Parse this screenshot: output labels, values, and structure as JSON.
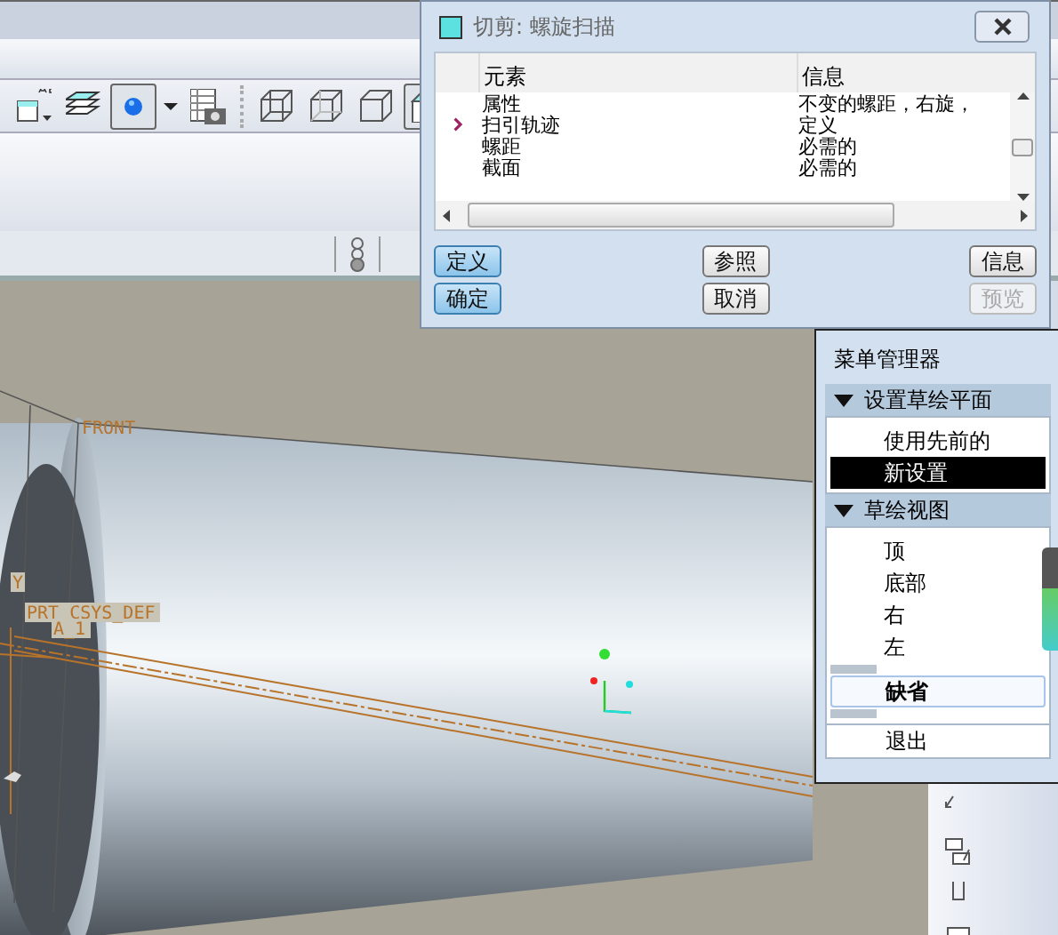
{
  "dialog": {
    "title": "切剪: 螺旋扫描",
    "columns": [
      "元素",
      "信息"
    ],
    "rows": [
      {
        "element": "属性",
        "info": "不变的螺距，右旋，",
        "current": false
      },
      {
        "element": "扫引轨迹",
        "info": "定义",
        "current": true
      },
      {
        "element": "螺距",
        "info": "必需的",
        "current": false
      },
      {
        "element": "截面",
        "info": "必需的",
        "current": false
      }
    ],
    "buttons": [
      {
        "label": "定义",
        "primary": true,
        "disabled": false
      },
      {
        "label": "参照",
        "primary": false,
        "disabled": false
      },
      {
        "label": "信息",
        "primary": false,
        "disabled": false
      },
      {
        "label": "确定",
        "primary": true,
        "disabled": false
      },
      {
        "label": "取消",
        "primary": false,
        "disabled": false
      },
      {
        "label": "预览",
        "primary": false,
        "disabled": true
      }
    ]
  },
  "menu_manager": {
    "title": "菜单管理器",
    "sections": [
      {
        "title": "设置草绘平面",
        "expanded": true,
        "items": [
          {
            "label": "使用先前的",
            "selected": false,
            "focused": false
          },
          {
            "label": "新设置",
            "selected": true,
            "focused": false
          }
        ]
      },
      {
        "title": "草绘视图",
        "expanded": true,
        "items": [
          {
            "label": "顶",
            "selected": false,
            "focused": false
          },
          {
            "label": "底部",
            "selected": false,
            "focused": false
          },
          {
            "label": "右",
            "selected": false,
            "focused": false
          },
          {
            "label": "左",
            "selected": false,
            "focused": false
          },
          {
            "label": "缺省",
            "selected": false,
            "focused": true
          }
        ]
      }
    ],
    "exit": "退出"
  },
  "toolbar": {
    "items": [
      {
        "kind": "annotation",
        "pressed": false
      },
      {
        "kind": "layers",
        "pressed": false
      },
      {
        "kind": "appearance",
        "pressed": true
      },
      {
        "kind": "caret",
        "pressed": false
      },
      {
        "kind": "table",
        "pressed": false
      },
      {
        "kind": "wireframe",
        "pressed": false
      },
      {
        "kind": "hidden",
        "pressed": false
      },
      {
        "kind": "nohidden",
        "pressed": false
      },
      {
        "kind": "shaded",
        "pressed": true
      }
    ]
  },
  "viewport": {
    "plane_label": "FRONT",
    "csys_label": "PRT_CSYS_DEF",
    "axis_label": "A_1",
    "csys_axis": "Y"
  }
}
